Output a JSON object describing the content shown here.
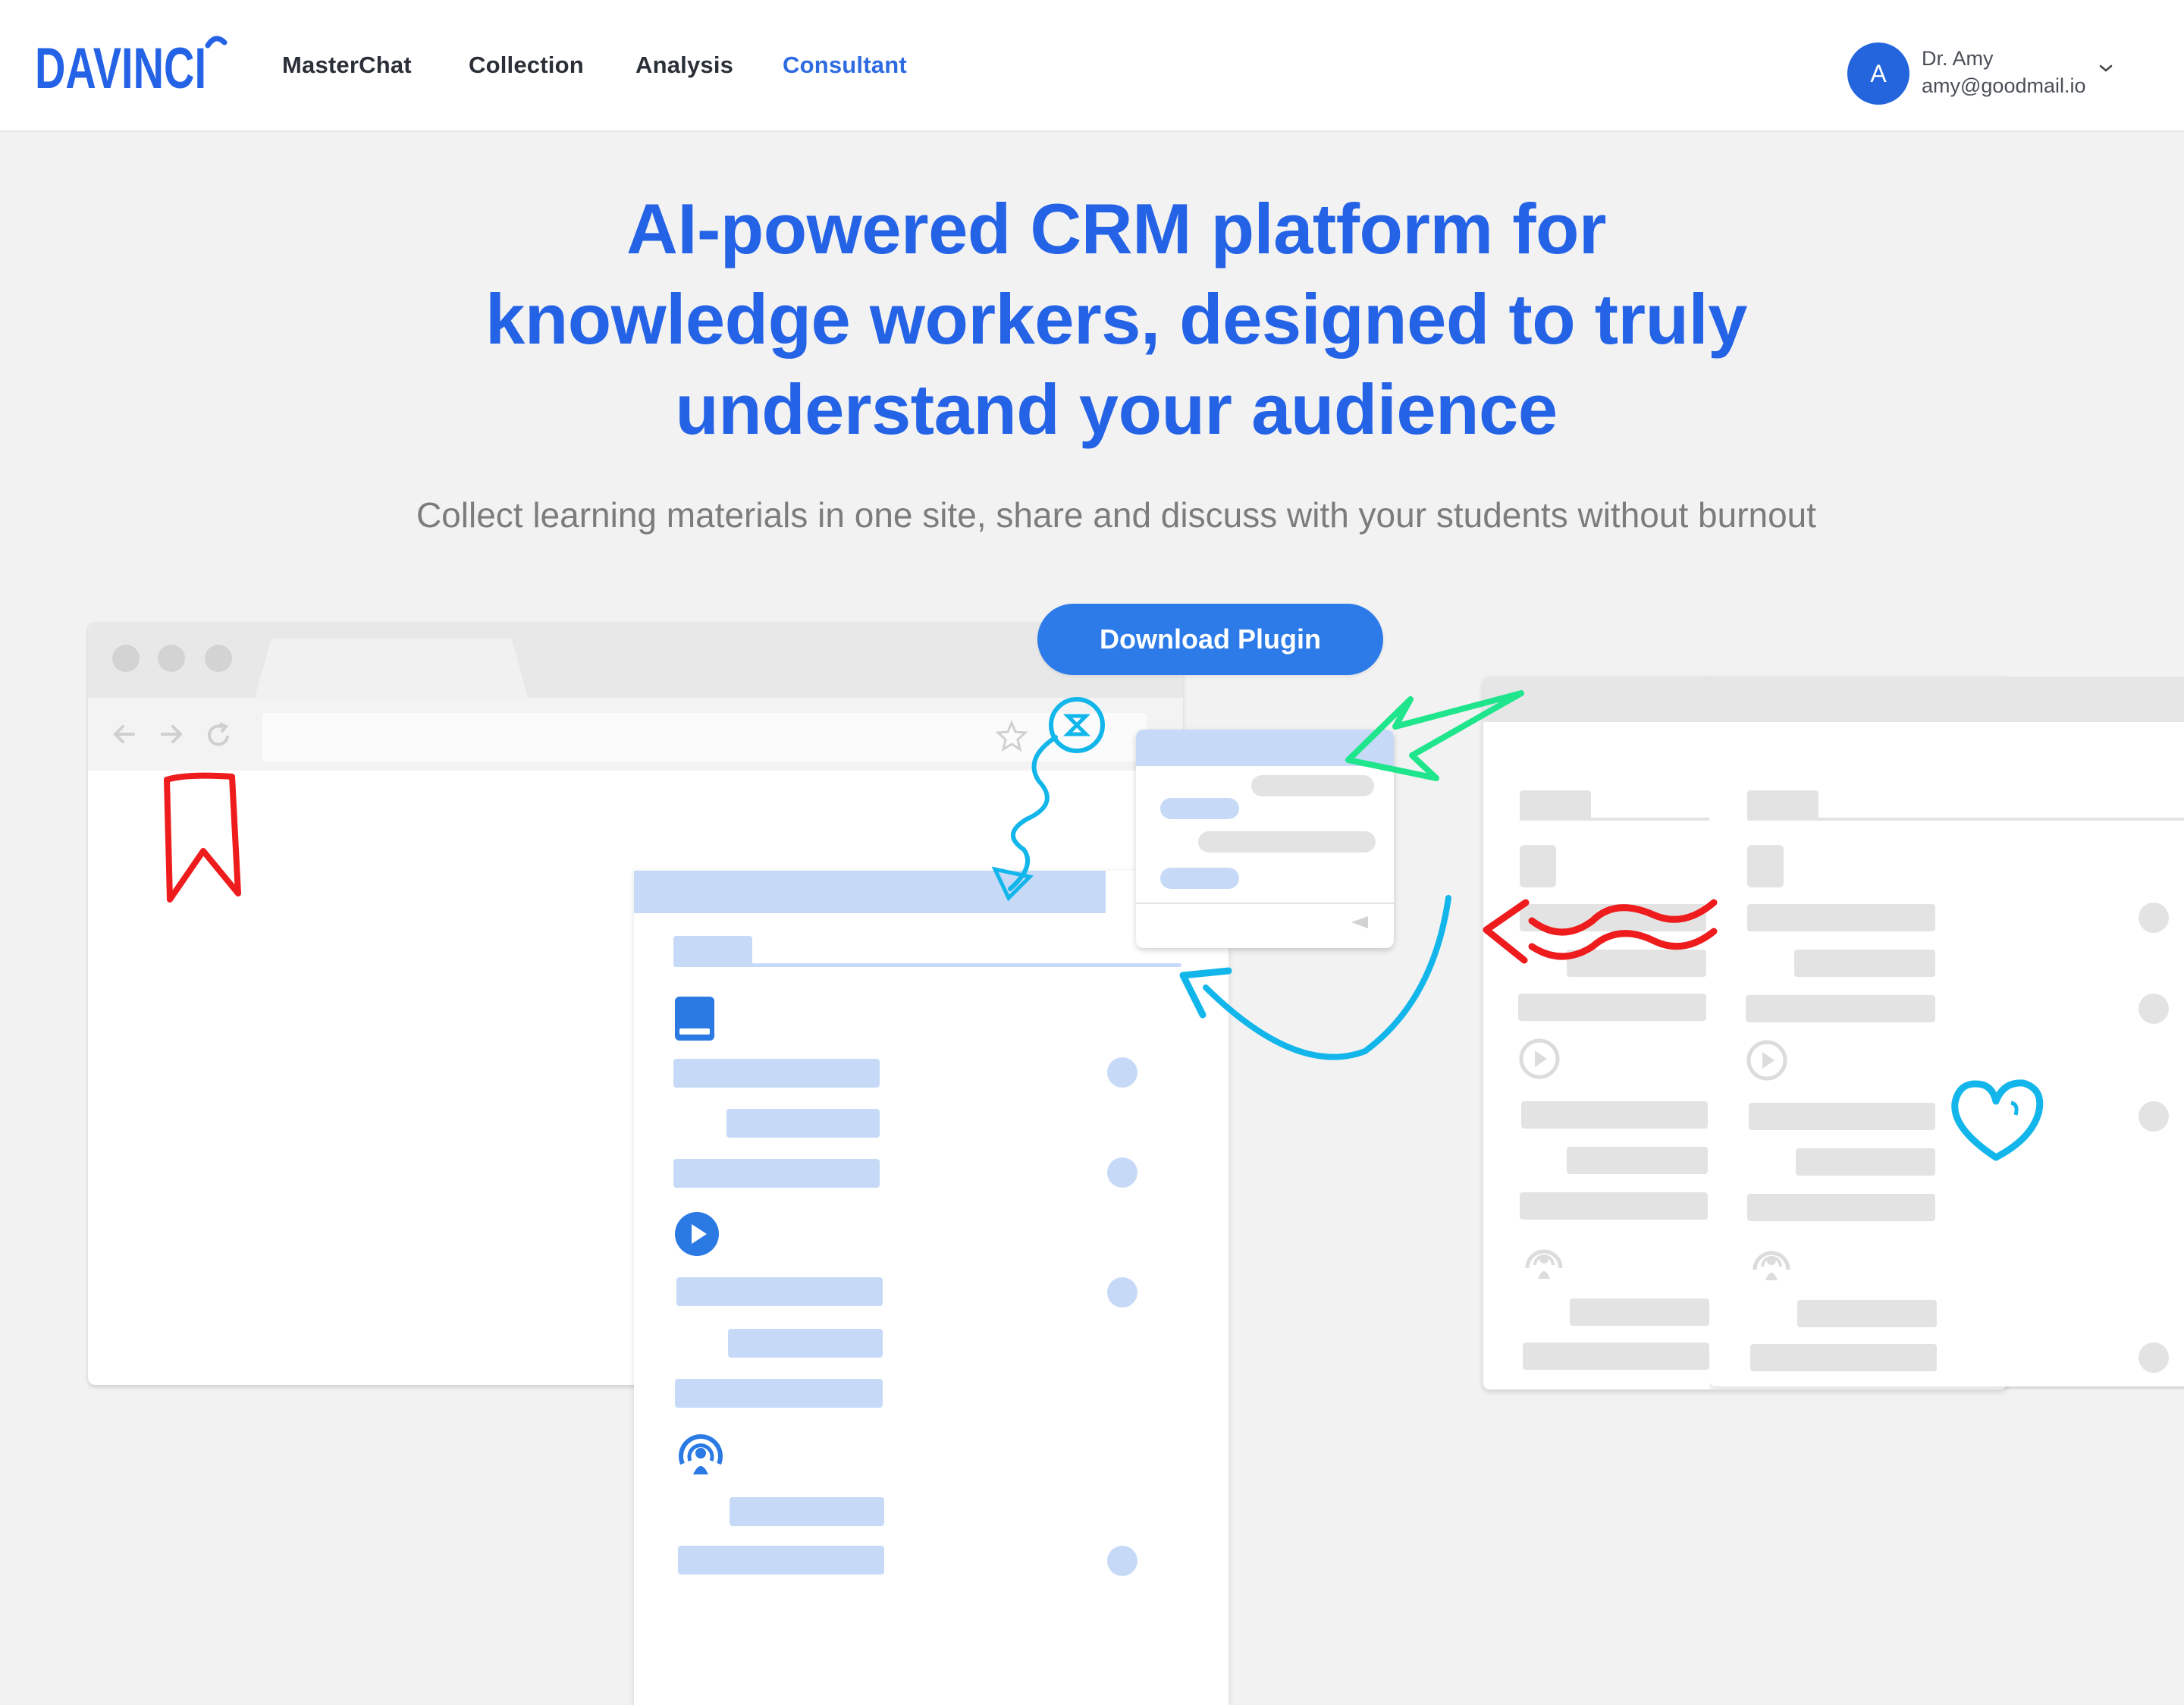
{
  "app": {
    "logo_text": "DAVINCI",
    "brand_color": "#2462e6",
    "accent_color": "#2c7be8"
  },
  "nav": {
    "items": [
      {
        "label": "MasterChat"
      },
      {
        "label": "Collection"
      },
      {
        "label": "Analysis"
      },
      {
        "label": "Consultant",
        "active": true
      }
    ]
  },
  "user": {
    "avatar_initial": "A",
    "name": "Dr. Amy",
    "email": "amy@goodmail.io",
    "menu_icon": "chevron-down-icon"
  },
  "hero": {
    "title_lines": [
      "AI-powered CRM platform for",
      "knowledge workers, designed to truly",
      "understand your audience"
    ],
    "subtitle": "Collect learning materials in one site, share and discuss with your students without burnout",
    "cta_label": "Download Plugin"
  },
  "illustration": {
    "icons": [
      "bookmark-icon",
      "book-icon",
      "play-icon",
      "podcast-icon",
      "heart-icon",
      "star-icon",
      "refresh-icon",
      "back-arrow-icon",
      "forward-arrow-icon"
    ],
    "annotation_colors": {
      "red": "#ee1c1c",
      "cyan": "#12b6ea",
      "green": "#1fe58c"
    }
  }
}
